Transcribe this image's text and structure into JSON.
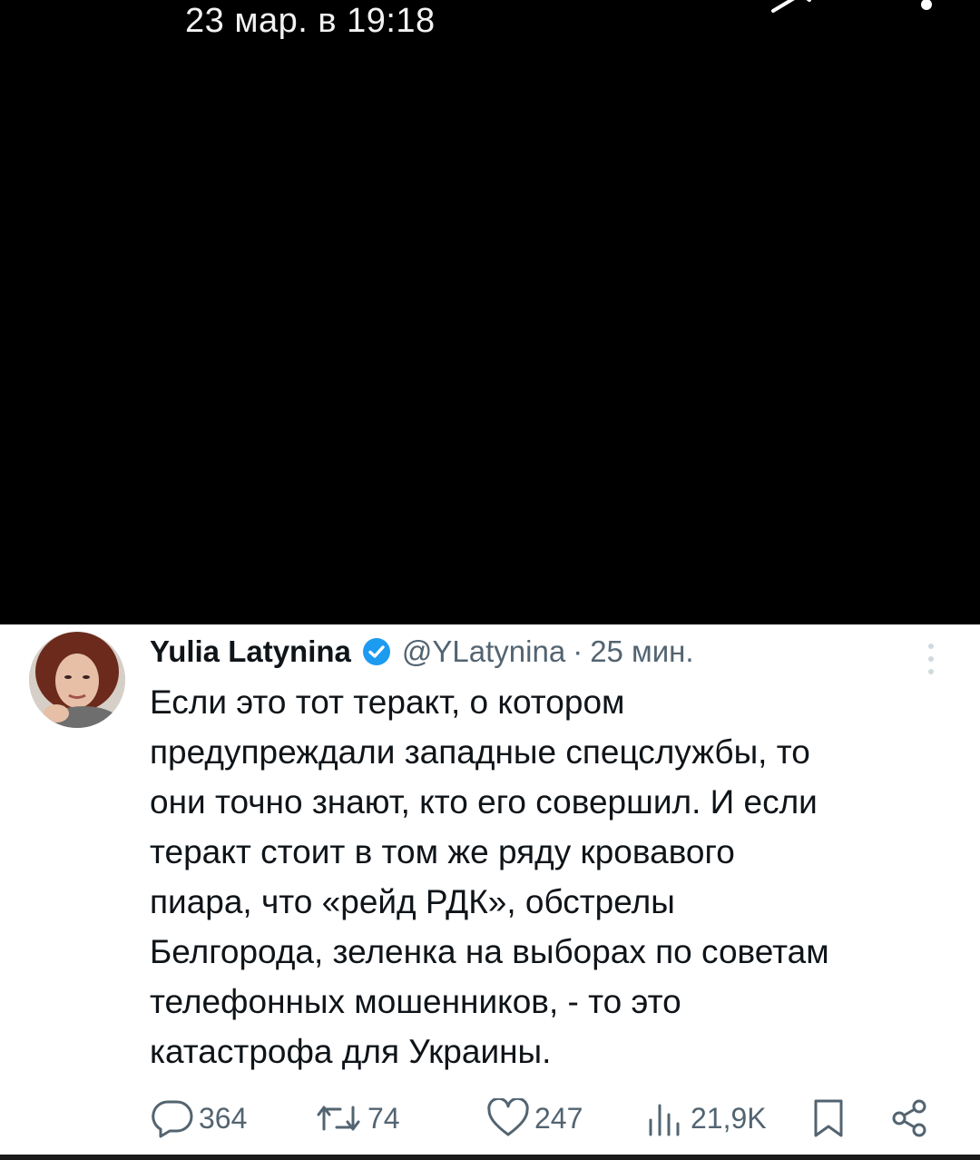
{
  "viewer": {
    "timestamp": "23 мар. в 19:18"
  },
  "tweet": {
    "author_name": "Yulia Latynina",
    "handle": "@YLatynina",
    "separator": "·",
    "time_ago": "25 мин.",
    "text": "Если это тот теракт, о котором\nпредупреждали западные спецслужбы, то\nони точно знают, кто его совершил. И если\nтеракт стоит в том же ряду кровавого\nпиара, что «рейд РДК», обстрелы\nБелгорода, зеленка на выборах по советам\nтелефонных мошенников, - то это\nкатастрофа для Украины.",
    "counts": {
      "replies": "364",
      "retweets": "74",
      "likes": "247",
      "views": "21,9K"
    }
  },
  "colors": {
    "verified": "#1d9bf0",
    "muted": "#536471",
    "text": "#0f1419"
  },
  "icons": {
    "reply": "reply-icon",
    "retweet": "retweet-icon",
    "like": "heart-icon",
    "views": "views-icon",
    "bookmark": "bookmark-icon",
    "share": "share-icon"
  }
}
